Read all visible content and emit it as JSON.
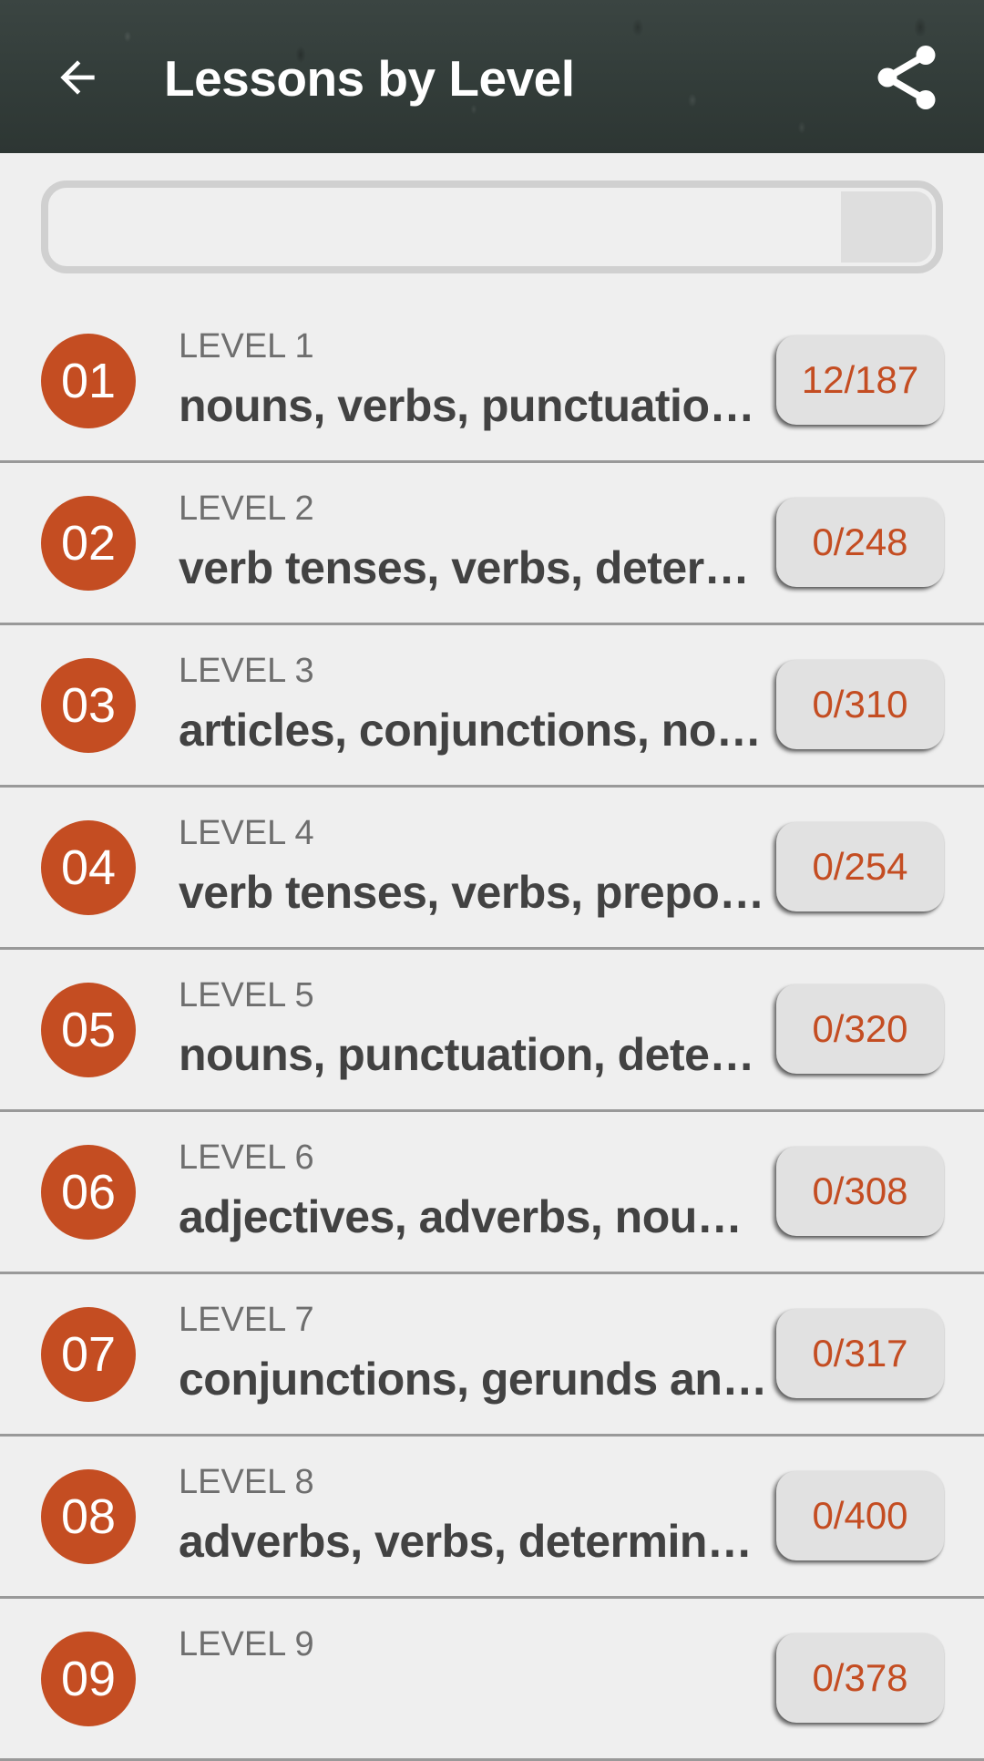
{
  "app_bar": {
    "title": "Lessons by Level",
    "back_icon": "arrow-left-icon",
    "share_icon": "share-icon"
  },
  "overall_progress": {
    "value_fraction": 0.0
  },
  "levels": [
    {
      "number": "01",
      "label": "LEVEL 1",
      "topics": "nouns, verbs, punctuatio…",
      "progress": "12/187"
    },
    {
      "number": "02",
      "label": "LEVEL 2",
      "topics": "verb tenses, verbs, deter…",
      "progress": "0/248"
    },
    {
      "number": "03",
      "label": "LEVEL 3",
      "topics": "articles, conjunctions, no…",
      "progress": "0/310"
    },
    {
      "number": "04",
      "label": "LEVEL 4",
      "topics": "verb tenses, verbs, prepo…",
      "progress": "0/254"
    },
    {
      "number": "05",
      "label": "LEVEL 5",
      "topics": "nouns, punctuation, dete…",
      "progress": "0/320"
    },
    {
      "number": "06",
      "label": "LEVEL 6",
      "topics": "adjectives, adverbs, nou…",
      "progress": "0/308"
    },
    {
      "number": "07",
      "label": "LEVEL 7",
      "topics": "conjunctions, gerunds an…",
      "progress": "0/317"
    },
    {
      "number": "08",
      "label": "LEVEL 8",
      "topics": "adverbs, verbs, determin…",
      "progress": "0/400"
    },
    {
      "number": "09",
      "label": "LEVEL 9",
      "topics": "",
      "progress": "0/378"
    }
  ],
  "colors": {
    "accent": "#c44d22",
    "background": "#efefef",
    "badge_bg": "#e1e1e1"
  }
}
